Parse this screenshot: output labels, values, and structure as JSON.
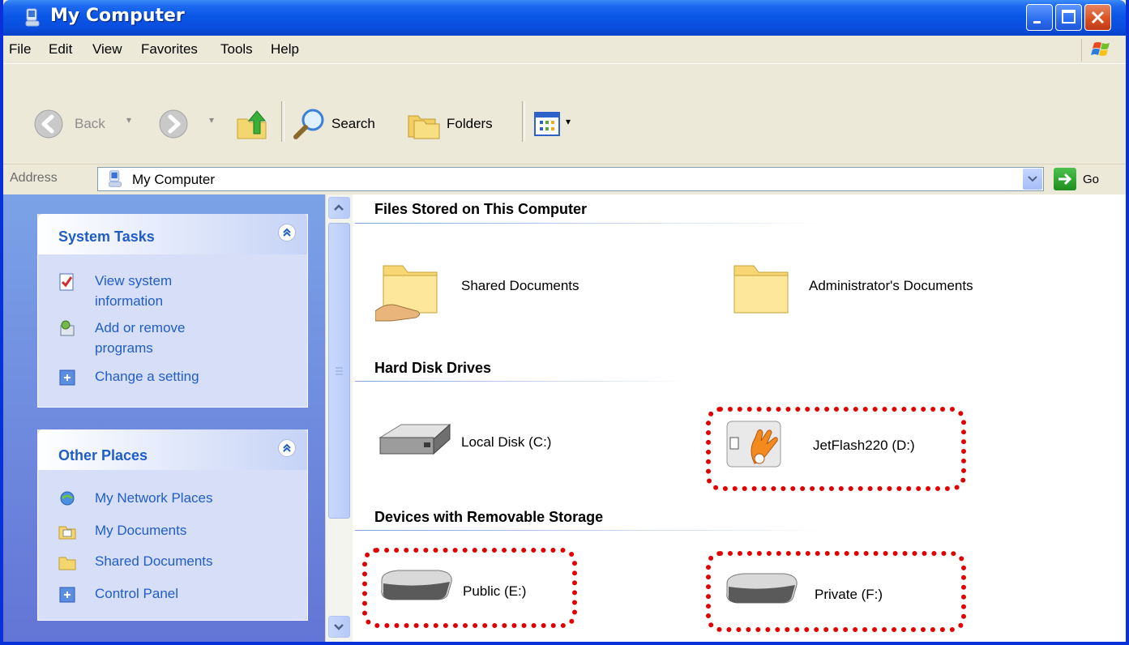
{
  "window": {
    "title": "My Computer"
  },
  "menu": [
    "File",
    "Edit",
    "View",
    "Favorites",
    "Tools",
    "Help"
  ],
  "toolbar": {
    "back_label": "Back",
    "search_label": "Search",
    "folders_label": "Folders"
  },
  "address": {
    "label": "Address",
    "value": "My Computer",
    "go_label": "Go"
  },
  "system_tasks": {
    "title": "System Tasks",
    "items": [
      {
        "label": "View system information",
        "icon": "system-info-icon"
      },
      {
        "label": "Add or remove programs",
        "icon": "add-remove-programs-icon"
      },
      {
        "label": "Change a setting",
        "icon": "control-panel-icon"
      }
    ]
  },
  "other_places": {
    "title": "Other Places",
    "items": [
      {
        "label": "My Network Places",
        "icon": "network-places-icon"
      },
      {
        "label": "My Documents",
        "icon": "my-documents-icon"
      },
      {
        "label": "Shared Documents",
        "icon": "folder-icon"
      },
      {
        "label": "Control Panel",
        "icon": "control-panel-icon"
      }
    ]
  },
  "groups": {
    "files": {
      "title": "Files Stored on This Computer",
      "items": [
        "Shared Documents",
        "Administrator's Documents"
      ]
    },
    "hdd": {
      "title": "Hard Disk Drives",
      "items": [
        "Local Disk (C:)",
        "JetFlash220 (D:)"
      ]
    },
    "removable": {
      "title": "Devices with Removable Storage",
      "items": [
        "Public (E:)",
        "Private (F:)"
      ]
    }
  },
  "colors": {
    "highlight": "#e00000",
    "link": "#215dc6",
    "titlebar": "#0a56e6"
  }
}
